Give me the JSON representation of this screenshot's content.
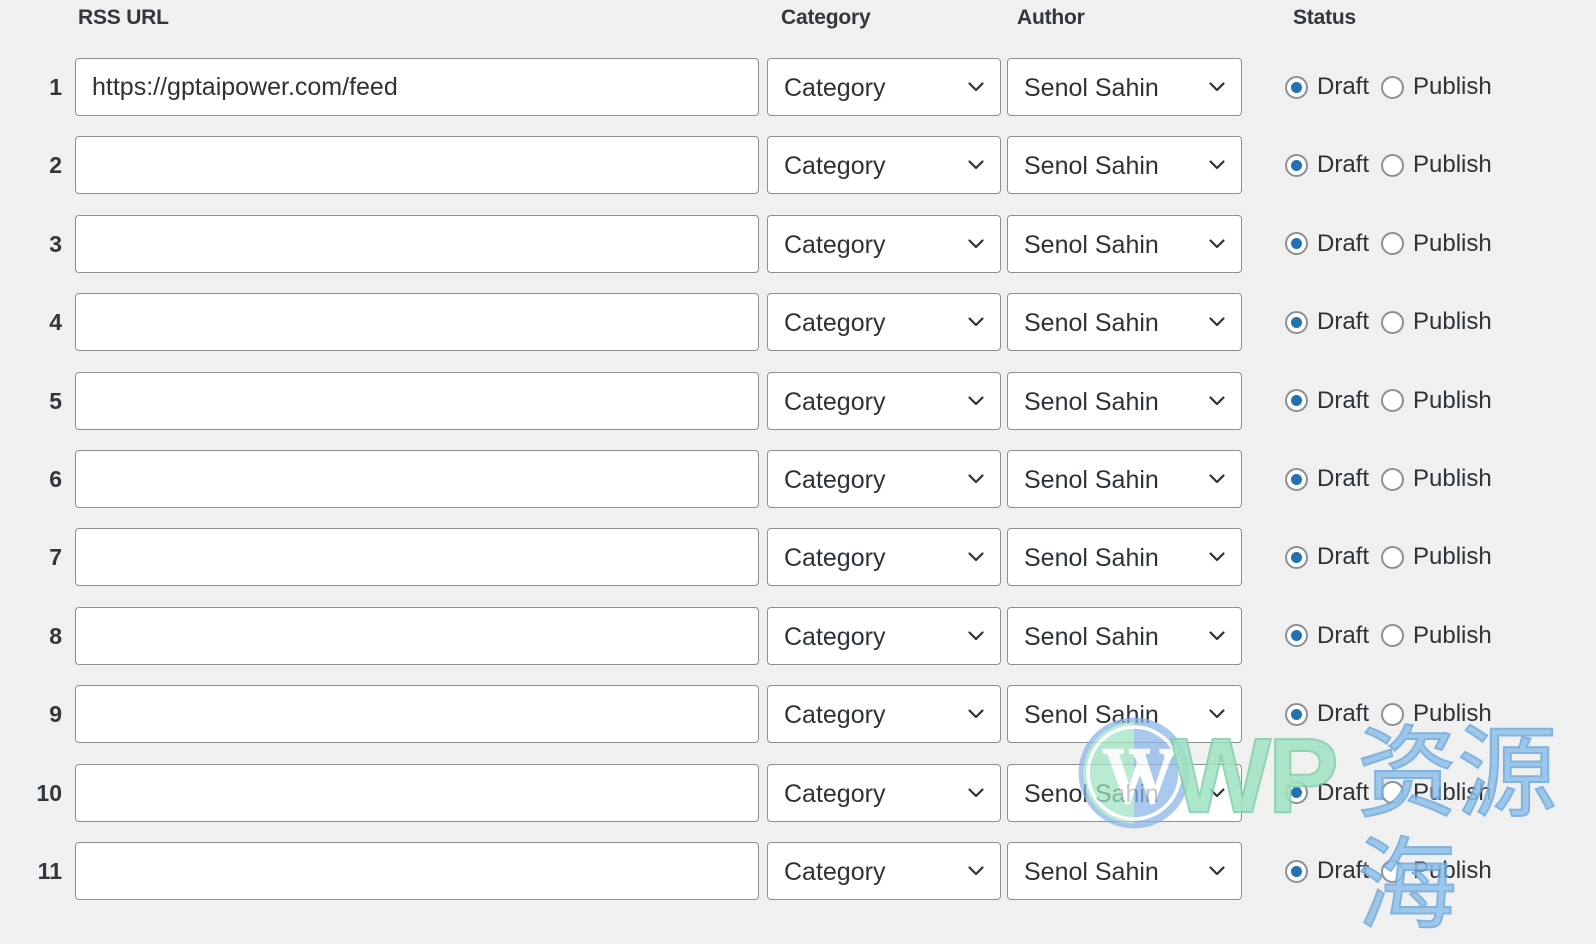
{
  "header": {
    "columns": [
      {
        "key": "rss_url",
        "label": "RSS URL"
      },
      {
        "key": "category",
        "label": "Category"
      },
      {
        "key": "author",
        "label": "Author"
      },
      {
        "key": "status",
        "label": "Status"
      }
    ]
  },
  "labels": {
    "url_placeholder": "",
    "status_draft": "Draft",
    "status_publish": "Publish",
    "chevron_icon": "chevron-down-icon"
  },
  "colors": {
    "page_background": "#f0f0f0",
    "field_background": "#ffffff",
    "field_border": "#8c8f94",
    "text": "#2c3338",
    "heading": "#32373c",
    "radio_selected": "#2271b1",
    "watermark_green": "#9fe3c2",
    "watermark_blue": "#8fc0ea"
  },
  "rows": [
    {
      "num": "1",
      "url": "https://gptaipower.com/feed",
      "category": "Category",
      "author": "Senol Sahin",
      "status": "Draft"
    },
    {
      "num": "2",
      "url": "",
      "category": "Category",
      "author": "Senol Sahin",
      "status": "Draft"
    },
    {
      "num": "3",
      "url": "",
      "category": "Category",
      "author": "Senol Sahin",
      "status": "Draft"
    },
    {
      "num": "4",
      "url": "",
      "category": "Category",
      "author": "Senol Sahin",
      "status": "Draft"
    },
    {
      "num": "5",
      "url": "",
      "category": "Category",
      "author": "Senol Sahin",
      "status": "Draft"
    },
    {
      "num": "6",
      "url": "",
      "category": "Category",
      "author": "Senol Sahin",
      "status": "Draft"
    },
    {
      "num": "7",
      "url": "",
      "category": "Category",
      "author": "Senol Sahin",
      "status": "Draft"
    },
    {
      "num": "8",
      "url": "",
      "category": "Category",
      "author": "Senol Sahin",
      "status": "Draft"
    },
    {
      "num": "9",
      "url": "",
      "category": "Category",
      "author": "Senol Sahin",
      "status": "Draft"
    },
    {
      "num": "10",
      "url": "",
      "category": "Category",
      "author": "Senol Sahin",
      "status": "Draft"
    },
    {
      "num": "11",
      "url": "",
      "category": "Category",
      "author": "Senol Sahin",
      "status": "Draft"
    }
  ],
  "watermark": {
    "logo": "wordpress-logo-icon",
    "text_latin": "WP",
    "text_cjk": "资源海"
  }
}
